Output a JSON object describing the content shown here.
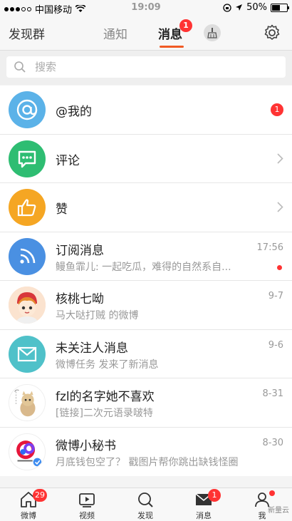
{
  "status": {
    "carrier": "中国移动",
    "time": "19:09",
    "battery": "50%"
  },
  "nav": {
    "left": "发现群",
    "tab_inactive": "通知",
    "tab_active": "消息",
    "tab_active_badge": "1"
  },
  "search": {
    "placeholder": "搜索"
  },
  "rows": [
    {
      "title": "@我的",
      "badge": "1"
    },
    {
      "title": "评论"
    },
    {
      "title": "赞"
    },
    {
      "title": "订阅消息",
      "time": "17:56",
      "sub": "鳗鱼霏儿: 一起吃瓜，难得的自然系自..."
    },
    {
      "title": "核桃七呦",
      "time": "9-7",
      "sub": "马大哒打贼 的微博"
    },
    {
      "title": "未关注人消息",
      "time": "9-6",
      "sub": "微博任务 发来了新消息"
    },
    {
      "title": "fzl的名字她不喜欢",
      "time": "8-31",
      "sub": "[链接]二次元语录啵特"
    },
    {
      "title": "微博小秘书",
      "time": "8-30",
      "sub": "月底钱包空了？ 戳图片帮你跳出缺钱怪圈"
    }
  ],
  "tabbar": {
    "weibo": "微博",
    "weibo_badge": "29",
    "video": "视频",
    "discover": "发现",
    "messages": "消息",
    "messages_badge": "1",
    "me": "我",
    "watermark": "新量云"
  },
  "colors": {
    "accent": "#f15a24",
    "badge": "#ff3333",
    "at": "#5bb2e8",
    "comment": "#2ebd72",
    "like": "#f5a623",
    "rss": "#4a90e2",
    "mail": "#4fc1c9"
  }
}
